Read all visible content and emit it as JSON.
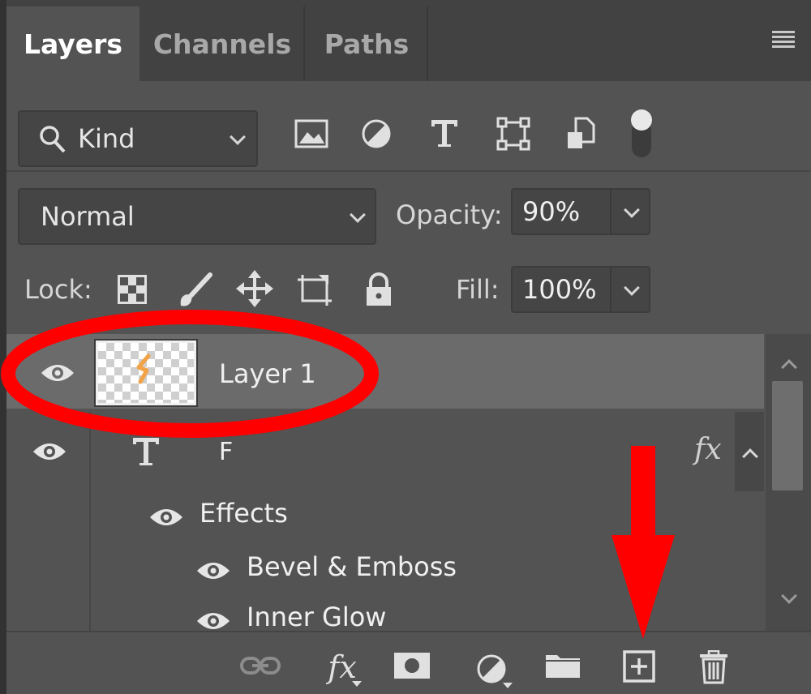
{
  "tabs": [
    {
      "label": "Layers",
      "active": true
    },
    {
      "label": "Channels",
      "active": false
    },
    {
      "label": "Paths",
      "active": false
    }
  ],
  "filter": {
    "kind_value": "Kind",
    "filter_icons": [
      "image-filter-icon",
      "adjustment-filter-icon",
      "type-filter-icon",
      "shape-filter-icon",
      "smart-object-filter-icon",
      "filter-toggle-icon"
    ]
  },
  "blend": {
    "mode": "Normal",
    "opacity_label": "Opacity:",
    "opacity_value": "90%"
  },
  "lock": {
    "label": "Lock:",
    "icons": [
      "lock-transparent-pixels-icon",
      "lock-image-pixels-icon",
      "lock-position-icon",
      "lock-artboard-icon",
      "lock-all-icon"
    ],
    "fill_label": "Fill:",
    "fill_value": "100%"
  },
  "layers": [
    {
      "name": "Layer 1",
      "selected": true
    },
    {
      "name": "F",
      "type": "text",
      "fx": "fx",
      "effects_label": "Effects",
      "effects": [
        "Bevel & Emboss",
        "Inner Glow"
      ]
    }
  ],
  "bottom_icons": [
    "link-layers-icon",
    "add-style-icon",
    "add-mask-icon",
    "new-adjustment-icon",
    "new-group-icon",
    "new-layer-icon",
    "delete-layer-icon"
  ],
  "colors": {
    "annotation": "#ff0000",
    "panel": "#535353",
    "selected_row": "#6b6b6b"
  }
}
